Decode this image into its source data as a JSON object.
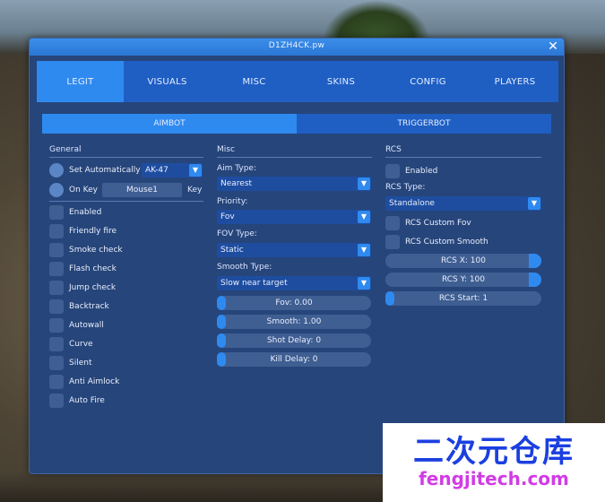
{
  "window": {
    "title": "D1ZH4CK.pw",
    "close_glyph": "✕"
  },
  "tabs": [
    {
      "label": "LEGIT",
      "active": true
    },
    {
      "label": "VISUALS",
      "active": false
    },
    {
      "label": "MISC",
      "active": false
    },
    {
      "label": "SKINS",
      "active": false
    },
    {
      "label": "CONFIG",
      "active": false
    },
    {
      "label": "PLAYERS",
      "active": false
    }
  ],
  "subtabs": [
    {
      "label": "AIMBOT",
      "active": true
    },
    {
      "label": "TRIGGERBOT",
      "active": false
    }
  ],
  "general": {
    "title": "General",
    "set_auto_label": "Set Automatically",
    "weapon_value": "AK-47",
    "on_key_label": "On Key",
    "key_value": "Mouse1",
    "key_label": "Key",
    "checkboxes": [
      "Enabled",
      "Friendly fire",
      "Smoke check",
      "Flash check",
      "Jump check",
      "Backtrack",
      "Autowall",
      "Curve",
      "Silent",
      "Anti Aimlock",
      "Auto Fire"
    ]
  },
  "misc": {
    "title": "Misc",
    "aim_type_label": "Aim Type:",
    "aim_type_value": "Nearest",
    "priority_label": "Priority:",
    "priority_value": "Fov",
    "fov_type_label": "FOV Type:",
    "fov_type_value": "Static",
    "smooth_type_label": "Smooth Type:",
    "smooth_type_value": "Slow near target",
    "sliders": [
      {
        "text": "Fov: 0.00",
        "fill": 0.0
      },
      {
        "text": "Smooth: 1.00",
        "fill": 0.0
      },
      {
        "text": "Shot Delay: 0",
        "fill": 0.0
      },
      {
        "text": "Kill Delay: 0",
        "fill": 0.0
      }
    ]
  },
  "rcs": {
    "title": "RCS",
    "enabled_label": "Enabled",
    "type_label": "RCS Type:",
    "type_value": "Standalone",
    "custom_fov_label": "RCS Custom Fov",
    "custom_smooth_label": "RCS Custom Smooth",
    "sliders": [
      {
        "text": "RCS X: 100",
        "fill": 1.0
      },
      {
        "text": "RCS Y: 100",
        "fill": 1.0
      },
      {
        "text": "RCS Start: 1",
        "fill": 0.0
      }
    ]
  },
  "watermark": {
    "cn": "二次元仓库",
    "en": "fengjitech.com"
  },
  "colors": {
    "accent": "#2f8af0",
    "panel": "#26457a",
    "control": "#3f5e92"
  }
}
